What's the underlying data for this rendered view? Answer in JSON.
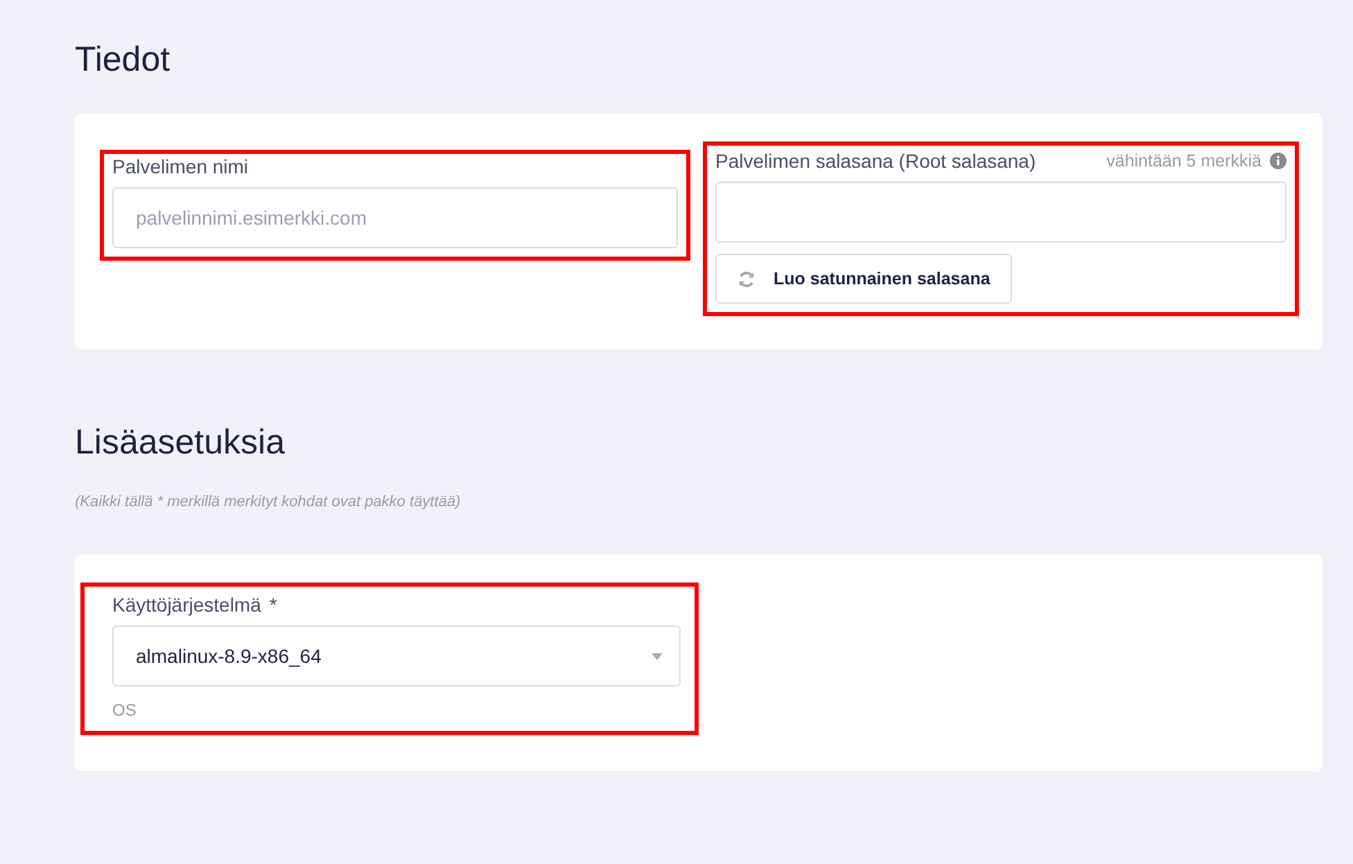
{
  "sections": [
    {
      "title": "Tiedot",
      "fields": [
        {
          "kind": "text",
          "label": "Palvelimen nimi",
          "placeholder": "palvelinnimi.esimerkki.com",
          "highlighted": true
        },
        {
          "kind": "password",
          "label": "Palvelimen salasana (Root salasana)",
          "hint": "vähintään 5 merkkiä",
          "button": "Luo satunnainen salasana",
          "highlighted": true
        }
      ]
    },
    {
      "title": "Lisäasetuksia",
      "note": "(Kaikki tällä * merkillä merkityt kohdat ovat pakko täyttää)",
      "fields": [
        {
          "kind": "select",
          "label": "Käyttöjärjestelmä",
          "required_mark": "*",
          "value": "almalinux-8.9-x86_64",
          "help": "OS",
          "highlighted": true
        }
      ]
    }
  ]
}
